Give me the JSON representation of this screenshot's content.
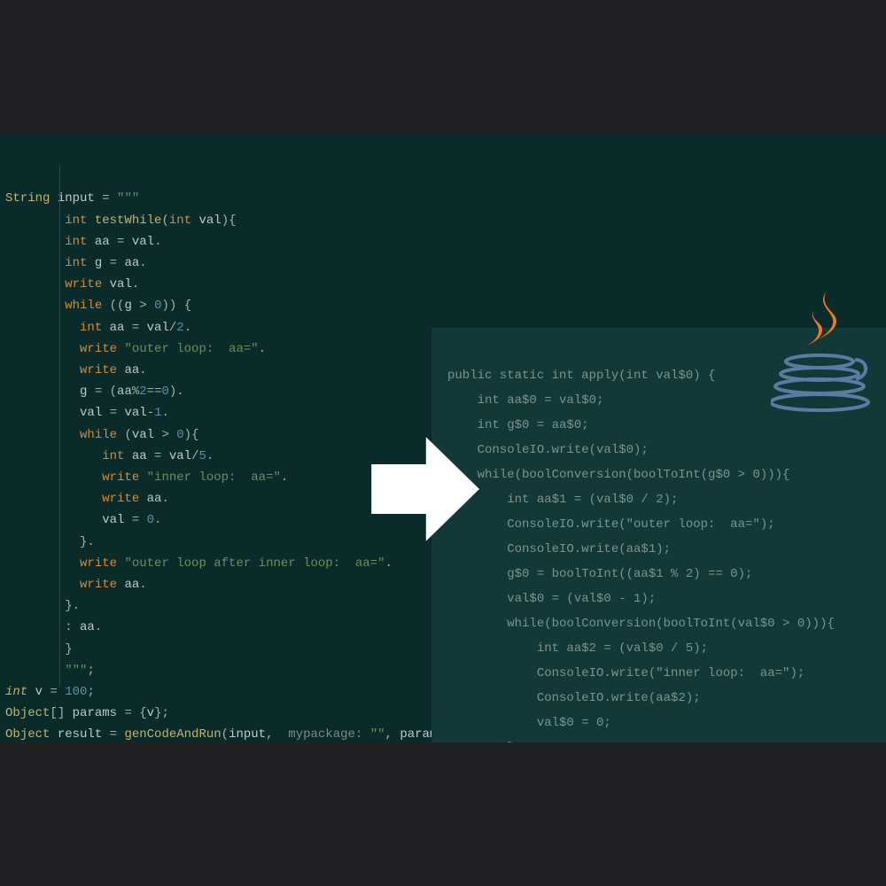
{
  "left": {
    "l1": {
      "a": "String ",
      "b": "input ",
      "c": "= ",
      "d": "\"\"\""
    },
    "l2": {
      "a": "int ",
      "b": "testWhile",
      "c": "(",
      "d": "int ",
      "e": "val",
      "f": "){"
    },
    "l3": {
      "a": "int ",
      "b": "aa ",
      "c": "= ",
      "d": "val",
      "e": "."
    },
    "l4": {
      "a": "int ",
      "b": "g ",
      "c": "= ",
      "d": "aa",
      "e": "."
    },
    "l5": {
      "a": "write ",
      "b": "val",
      "c": "."
    },
    "l6": {
      "a": "while ",
      "b": "((",
      "c": "g ",
      "d": "> ",
      "e": "0",
      "f": ")) {"
    },
    "l7": {
      "a": "int ",
      "b": "aa ",
      "c": "= ",
      "d": "val",
      "e": "/",
      "f": "2",
      "g": "."
    },
    "l8": {
      "a": "write ",
      "b": "\"outer loop:  aa=\"",
      "c": "."
    },
    "l9": {
      "a": "write ",
      "b": "aa",
      "c": "."
    },
    "l10": {
      "a": "g ",
      "b": "= (",
      "c": "aa",
      "d": "%",
      "e": "2",
      "f": "==",
      "g": "0",
      "h": ")."
    },
    "l11": {
      "a": "val ",
      "b": "= ",
      "c": "val",
      "d": "-",
      "e": "1",
      "f": "."
    },
    "l12": {
      "a": "while ",
      "b": "(",
      "c": "val ",
      "d": "> ",
      "e": "0",
      "f": "){"
    },
    "l13": {
      "a": "int ",
      "b": "aa ",
      "c": "= ",
      "d": "val",
      "e": "/",
      "f": "5",
      "g": "."
    },
    "l14": {
      "a": "write ",
      "b": "\"inner loop:  aa=\"",
      "c": "."
    },
    "l15": {
      "a": "write ",
      "b": "aa",
      "c": "."
    },
    "l16": {
      "a": "val ",
      "b": "= ",
      "c": "0",
      "d": "."
    },
    "l17": {
      "a": "}."
    },
    "l18": {
      "a": "write ",
      "b": "\"outer loop after inner loop:  aa=\"",
      "c": "."
    },
    "l19": {
      "a": "write ",
      "b": "aa",
      "c": "."
    },
    "l20": {
      "a": "}."
    },
    "l21": {
      "a": ": ",
      "b": "aa",
      "c": "."
    },
    "l22": {
      "a": "}"
    },
    "l23": {
      "a": "\"\"\"",
      "b": ";"
    },
    "l24": {
      "a": "int ",
      "b": "v ",
      "c": "= ",
      "d": "100",
      "e": ";"
    },
    "l25": {
      "a": "Object",
      "b": "[] ",
      "c": "params ",
      "d": "= {",
      "e": "v",
      "f": "};"
    },
    "l26": {
      "a": "Object ",
      "b": "result ",
      "c": "= ",
      "d": "genCodeAndRun",
      "e": "(",
      "f": "input",
      "g": ",  ",
      "h": "mypackage: ",
      "i": "\"\"",
      "j": ", ",
      "k": "params",
      "l": ");"
    }
  },
  "right": {
    "r1": "public static int apply(int val$0) {",
    "r2": "    int aa$0 = val$0;",
    "r3": "    int g$0 = aa$0;",
    "r4": "    ConsoleIO.write(val$0);",
    "r5": "    while(boolConversion(boolToInt(g$0 > 0))){",
    "r6": "        int aa$1 = (val$0 / 2);",
    "r7": "        ConsoleIO.write(\"outer loop:  aa=\");",
    "r8": "        ConsoleIO.write(aa$1);",
    "r9": "        g$0 = boolToInt((aa$1 % 2) == 0);",
    "r10": "        val$0 = (val$0 - 1);",
    "r11": "        while(boolConversion(boolToInt(val$0 > 0))){",
    "r12": "            int aa$2 = (val$0 / 5);",
    "r13": "            ConsoleIO.write(\"inner loop:  aa=\");",
    "r14": "            ConsoleIO.write(aa$2);",
    "r15": "            val$0 = 0;",
    "r16": "        }"
  }
}
